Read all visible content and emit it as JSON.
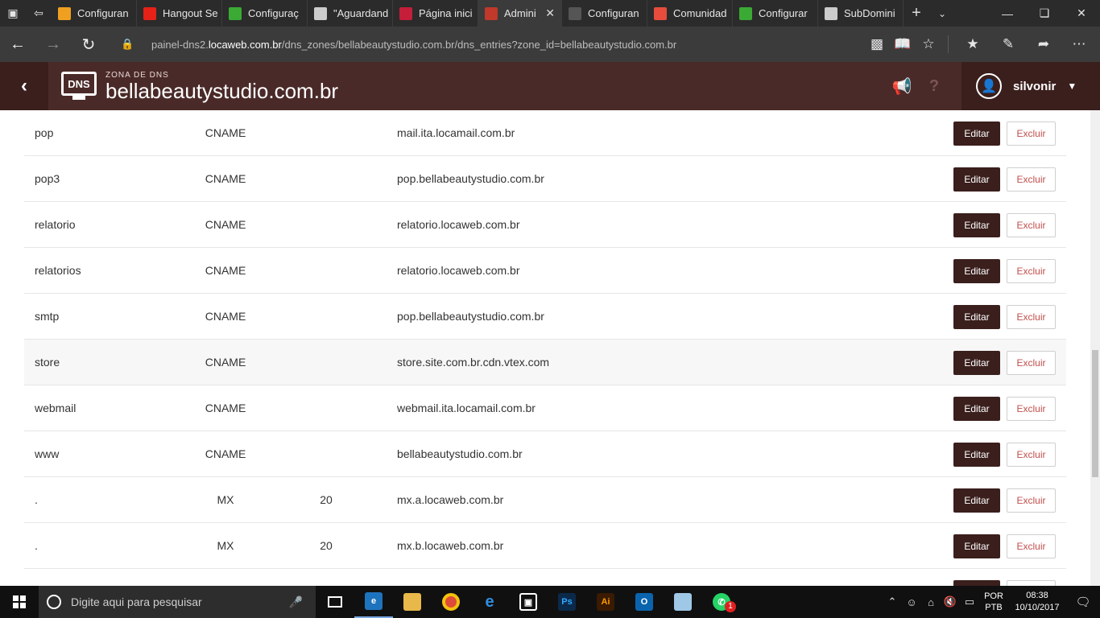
{
  "browser": {
    "tabs": [
      {
        "title": "Configuran",
        "icon": "cube-icon",
        "color": "#f0a020"
      },
      {
        "title": "Hangout Se",
        "icon": "youtube-icon",
        "color": "#e62117"
      },
      {
        "title": "Configuraç",
        "icon": "cube-icon",
        "color": "#3aaa35"
      },
      {
        "title": "\"Aguardand",
        "icon": "page-icon",
        "color": "#cccccc"
      },
      {
        "title": "Página inici",
        "icon": "w-icon",
        "color": "#c41e3a"
      },
      {
        "title": "Admini",
        "icon": "lw-icon",
        "color": "#c0392b"
      },
      {
        "title": "Configuran",
        "icon": "page-icon",
        "color": "#555555"
      },
      {
        "title": "Comunidad",
        "icon": "cube-icon",
        "color": "#e74c3c"
      },
      {
        "title": "Configurar",
        "icon": "cube-icon",
        "color": "#3aaa35"
      },
      {
        "title": "SubDomini",
        "icon": "page-icon",
        "color": "#cccccc"
      }
    ],
    "url_prefix": "painel-dns2.",
    "url_domain": "locaweb.com.br",
    "url_path": "/dns_zones/bellabeautystudio.com.br/dns_entries?zone_id=bellabeautystudio.com.br"
  },
  "header": {
    "logo_text": "DNS",
    "subtitle": "ZONA DE DNS",
    "title": "bellabeautystudio.com.br",
    "user": "silvonir"
  },
  "colors": {
    "brand_dark": "#3a1f1d",
    "brand": "#4a2a28",
    "delete_text": "#c0504d"
  },
  "actions": {
    "edit": "Editar",
    "delete": "Excluir"
  },
  "records": [
    {
      "name": "pop",
      "type": "CNAME",
      "priority": "",
      "value": "mail.ita.locamail.com.br"
    },
    {
      "name": "pop3",
      "type": "CNAME",
      "priority": "",
      "value": "pop.bellabeautystudio.com.br"
    },
    {
      "name": "relatorio",
      "type": "CNAME",
      "priority": "",
      "value": "relatorio.locaweb.com.br"
    },
    {
      "name": "relatorios",
      "type": "CNAME",
      "priority": "",
      "value": "relatorio.locaweb.com.br"
    },
    {
      "name": "smtp",
      "type": "CNAME",
      "priority": "",
      "value": "pop.bellabeautystudio.com.br"
    },
    {
      "name": "store",
      "type": "CNAME",
      "priority": "",
      "value": "store.site.com.br.cdn.vtex.com"
    },
    {
      "name": "webmail",
      "type": "CNAME",
      "priority": "",
      "value": "webmail.ita.locamail.com.br"
    },
    {
      "name": "www",
      "type": "CNAME",
      "priority": "",
      "value": "bellabeautystudio.com.br"
    },
    {
      "name": ".",
      "type": "MX",
      "priority": "20",
      "value": "mx.a.locaweb.com.br"
    },
    {
      "name": ".",
      "type": "MX",
      "priority": "20",
      "value": "mx.b.locaweb.com.br"
    },
    {
      "name": "",
      "type": "",
      "priority": "",
      "value": ""
    }
  ],
  "taskbar": {
    "search_placeholder": "Digite aqui para pesquisar",
    "lang_line1": "POR",
    "lang_line2": "PTB",
    "time": "08:38",
    "date": "10/10/2017",
    "badge": "1"
  }
}
